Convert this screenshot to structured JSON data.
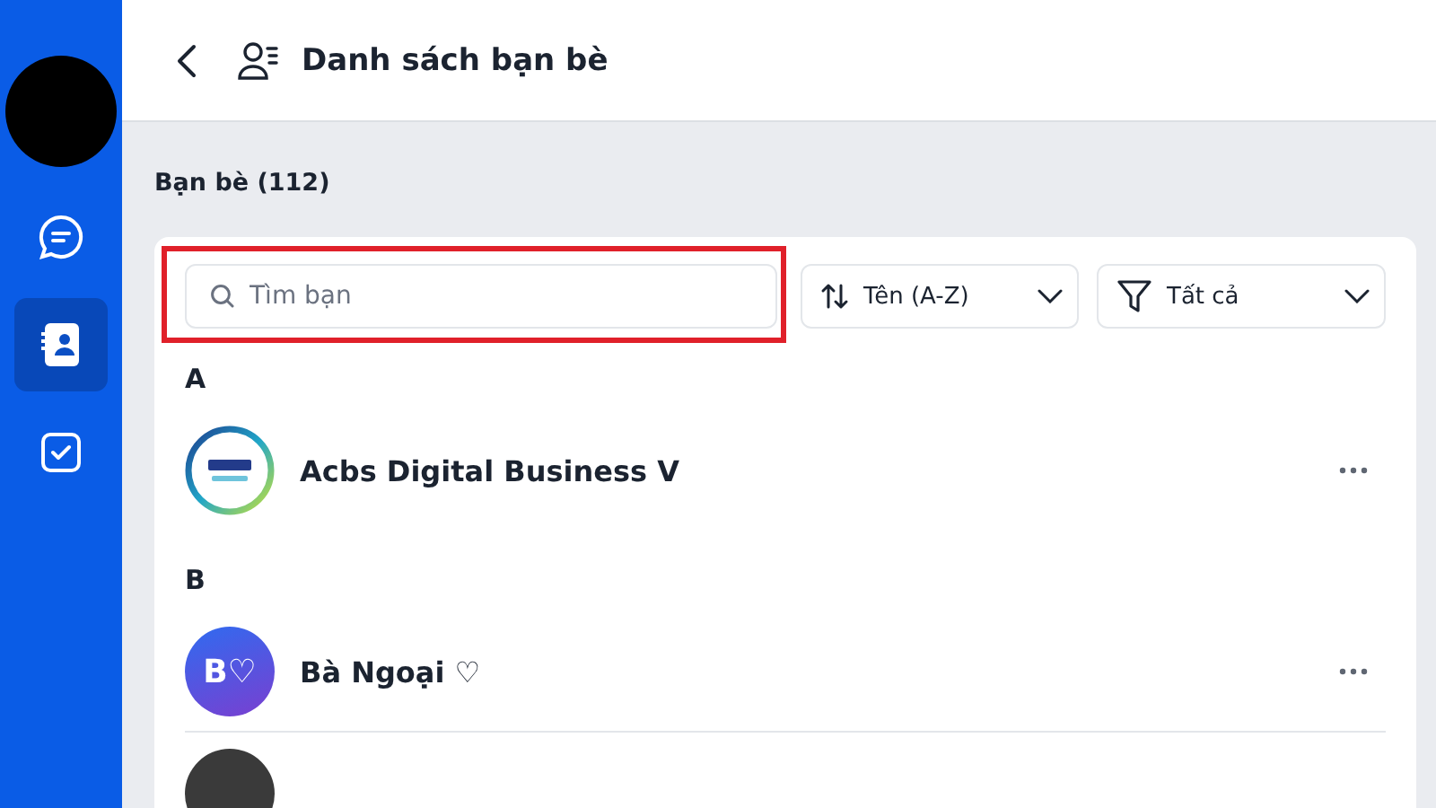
{
  "sidebar": {
    "items": [
      {
        "kind": "chat",
        "selected": false
      },
      {
        "kind": "contacts",
        "selected": true
      },
      {
        "kind": "tasks",
        "selected": false
      }
    ]
  },
  "header": {
    "title": "Danh sách bạn bè"
  },
  "friends": {
    "title": "Bạn bè (112)",
    "search": {
      "placeholder": "Tìm bạn",
      "highlighted": true
    },
    "sort": {
      "label": "Tên (A-Z)"
    },
    "filter": {
      "label": "Tất cả"
    },
    "sections": [
      {
        "letter": "A",
        "contacts": [
          {
            "kind": "logo",
            "name": "Acbs Digital Business V"
          }
        ]
      },
      {
        "letter": "B",
        "contacts": [
          {
            "kind": "initials",
            "initials": "B♡",
            "name": "Bà Ngoại ♡"
          },
          {
            "kind": "photo"
          }
        ]
      }
    ]
  }
}
